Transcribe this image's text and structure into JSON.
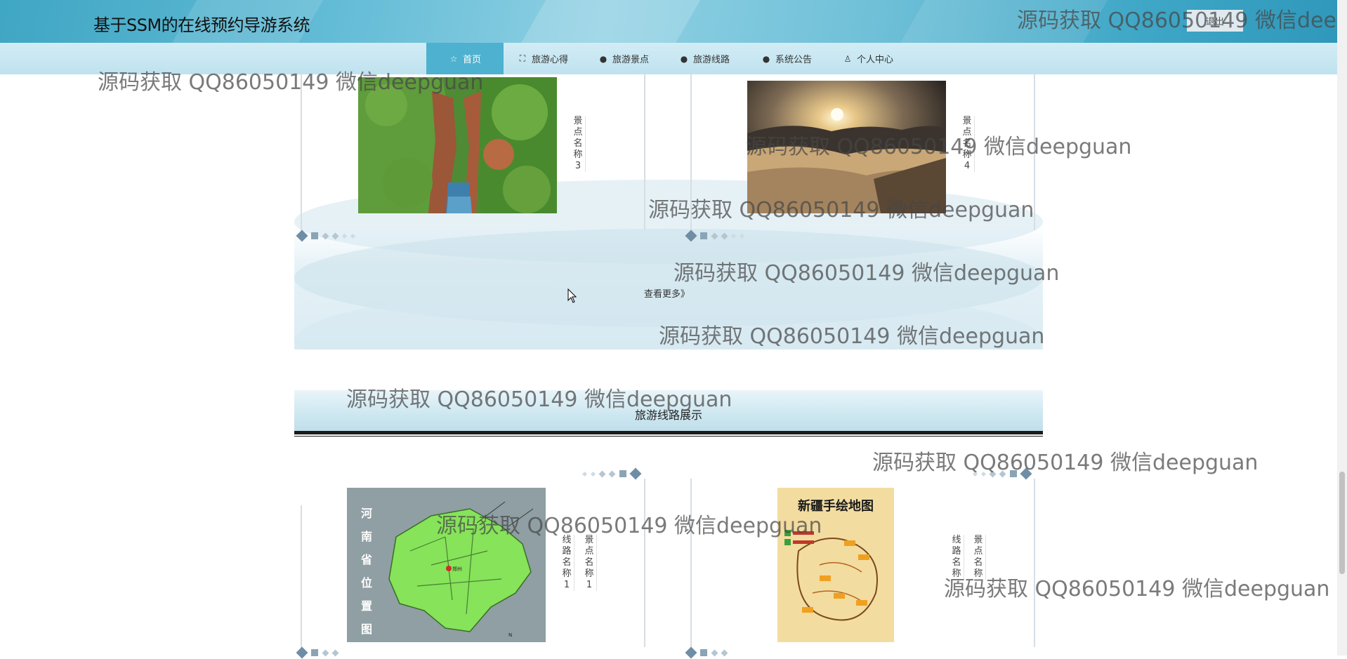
{
  "header": {
    "site_title": "基于SSM的在线预约导游系统",
    "user_mark": "\u0000",
    "logout_label": "退出"
  },
  "nav": {
    "items": [
      {
        "label": "首页",
        "icon": "star-icon"
      },
      {
        "label": "旅游心得",
        "icon": "bag-icon"
      },
      {
        "label": "旅游景点",
        "icon": "exclamation-icon"
      },
      {
        "label": "旅游线路",
        "icon": "question-icon"
      },
      {
        "label": "系统公告",
        "icon": "info-icon"
      },
      {
        "label": "个人中心",
        "icon": "user-icon"
      }
    ]
  },
  "scenic_section": {
    "cards": [
      {
        "label": "景点名称3",
        "image": "canyon-photo"
      },
      {
        "label": "景点名称4",
        "image": "sea-of-clouds-photo"
      }
    ],
    "more_label": "查看更多》"
  },
  "route_section": {
    "title": "旅游线路展示",
    "cards": [
      {
        "route_label": "线路名称1",
        "spot_label": "景点名称1",
        "image": "henan-map",
        "map_chars": [
          "河",
          "南",
          "省",
          "位",
          "置",
          "图"
        ]
      },
      {
        "route_label": "线路名称",
        "spot_label": "景点名称",
        "image": "xinjiang-map",
        "map_title": "新疆手绘地图"
      }
    ]
  },
  "watermarks": {
    "text": "源码获取 QQ86050149 微信deepguan",
    "text_cut": "源码获取 QQ86050149 微信deepg"
  },
  "colors": {
    "header": "#4eb1cf",
    "nav_active": "#4eb1cf",
    "nav_bg": "#c9e8f2"
  }
}
